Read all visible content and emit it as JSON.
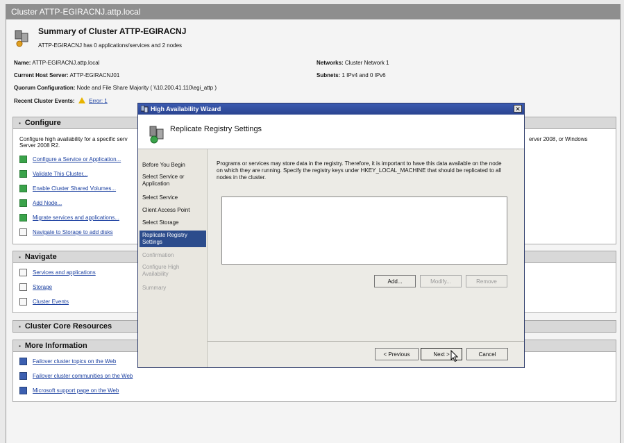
{
  "window": {
    "title": "Cluster ATTP-EGIRACNJ.attp.local"
  },
  "summary": {
    "title": "Summary of Cluster ATTP-EGIRACNJ",
    "subtitle": "ATTP-EGIRACNJ has 0 applications/services and 2 nodes"
  },
  "info": {
    "name_label": "Name:",
    "name_value": "ATTP-EGIRACNJ.attp.local",
    "host_label": "Current Host Server:",
    "host_value": "ATTP-EGIRACNJ01",
    "quorum_label": "Quorum Configuration:",
    "quorum_value": "Node and File Share Majority ( \\\\10.200.41.110\\egi_attp )",
    "events_label": "Recent Cluster Events:",
    "events_value": "Error: 1",
    "networks_label": "Networks:",
    "networks_value": "Cluster Network 1",
    "subnets_label": "Subnets:",
    "subnets_value": "1 IPv4 and 0 IPv6"
  },
  "configure": {
    "title": "Configure",
    "desc1": "Configure high availability for a specific serv",
    "desc1_right": "erver 2008, or Windows",
    "desc2": "Server 2008 R2.",
    "links": [
      "Configure a Service or Application...",
      "Validate This Cluster...",
      "Enable Cluster Shared Volumes...",
      "Add Node...",
      "Migrate services and applications...",
      "Navigate to Storage to add disks"
    ]
  },
  "navigate": {
    "title": "Navigate",
    "links": [
      "Services and applications",
      "Storage",
      "Cluster Events"
    ]
  },
  "core": {
    "title": "Cluster Core Resources"
  },
  "more": {
    "title": "More Information",
    "links": [
      "Failover cluster topics on the Web",
      "Failover cluster communities on the Web",
      "Microsoft support page on the Web"
    ]
  },
  "wizard": {
    "title": "High Availability Wizard",
    "close": "✕",
    "heading": "Replicate Registry Settings",
    "steps": [
      "Before You Begin",
      "Select Service or Application",
      "Select Service",
      "Client Access Point",
      "Select Storage",
      "Replicate Registry Settings",
      "Confirmation",
      "Configure High Availability",
      "Summary"
    ],
    "description": "Programs or services may store data in the registry.  Therefore, it is important to have this data available on the node on which they are running.  Specify the registry keys under HKEY_LOCAL_MACHINE that should be replicated to all nodes in the cluster.",
    "add_label": "Add...",
    "modify_label": "Modify...",
    "remove_label": "Remove",
    "prev_label": "< Previous",
    "next_label": "Next >",
    "cancel_label": "Cancel"
  }
}
